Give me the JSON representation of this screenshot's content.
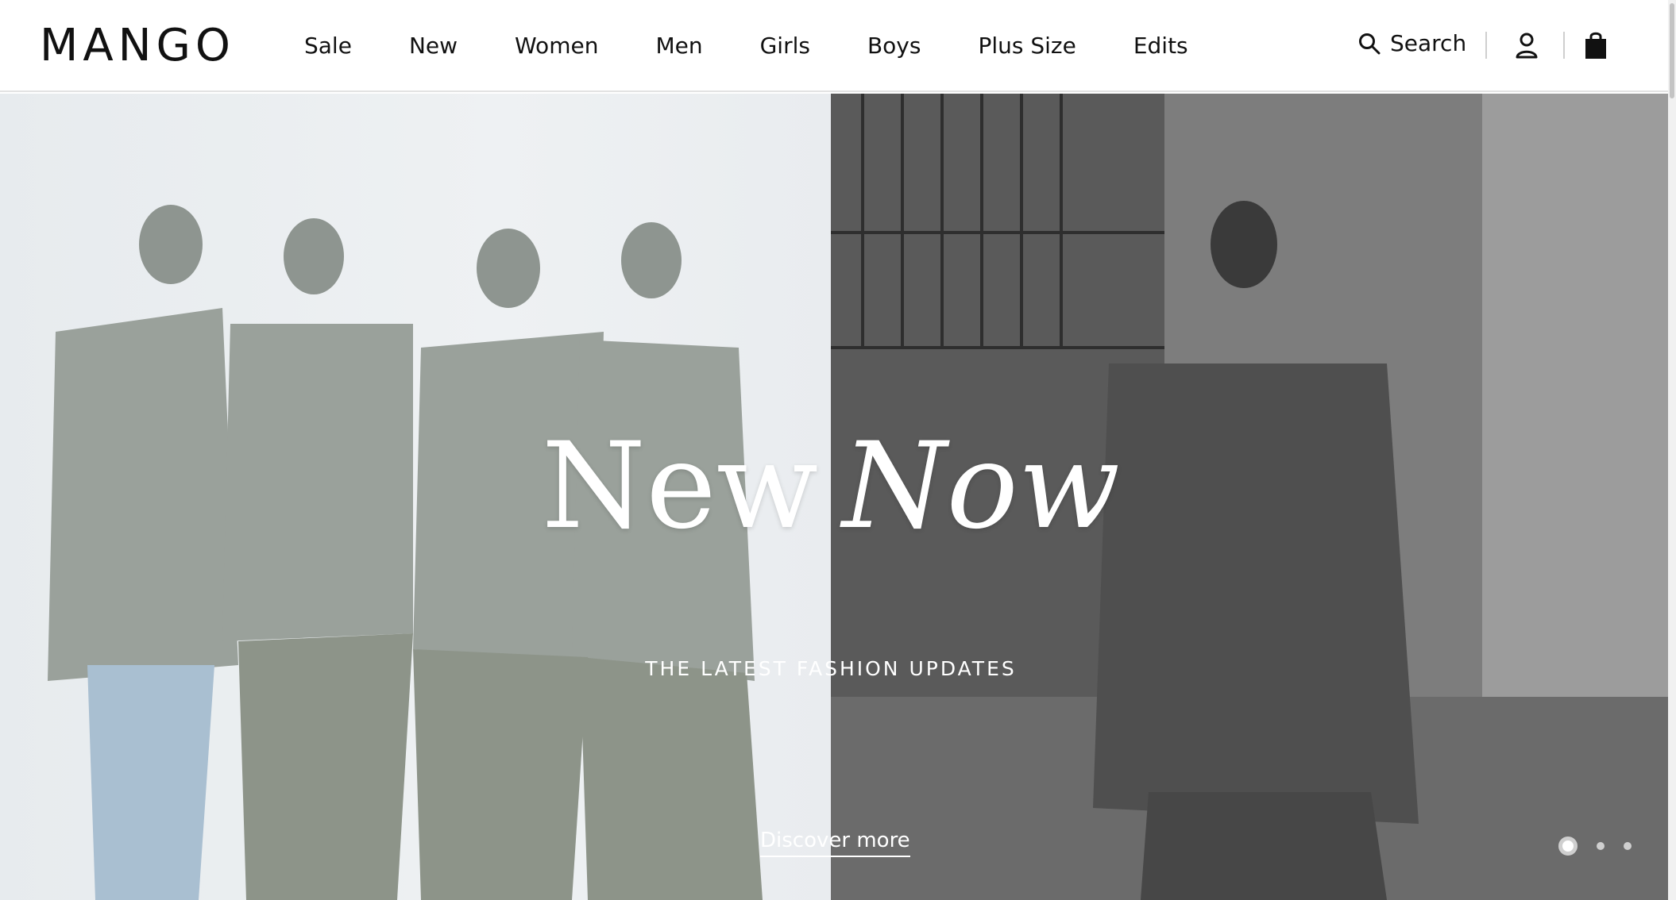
{
  "header": {
    "logo": "MANGO",
    "nav": [
      "Sale",
      "New",
      "Women",
      "Men",
      "Girls",
      "Boys",
      "Plus Size",
      "Edits"
    ],
    "search_label": "Search",
    "icons": [
      "search-icon",
      "user-icon",
      "shopping-bag-icon"
    ]
  },
  "hero": {
    "title_part1": "New",
    "title_part2": "Now",
    "subtitle": "THE LATEST FASHION UPDATES",
    "cta": "Discover more",
    "slides_total": 3,
    "active_slide": 1
  },
  "colors": {
    "text": "#111111",
    "hero_text": "#ffffff",
    "divider": "#cfcfcf"
  }
}
